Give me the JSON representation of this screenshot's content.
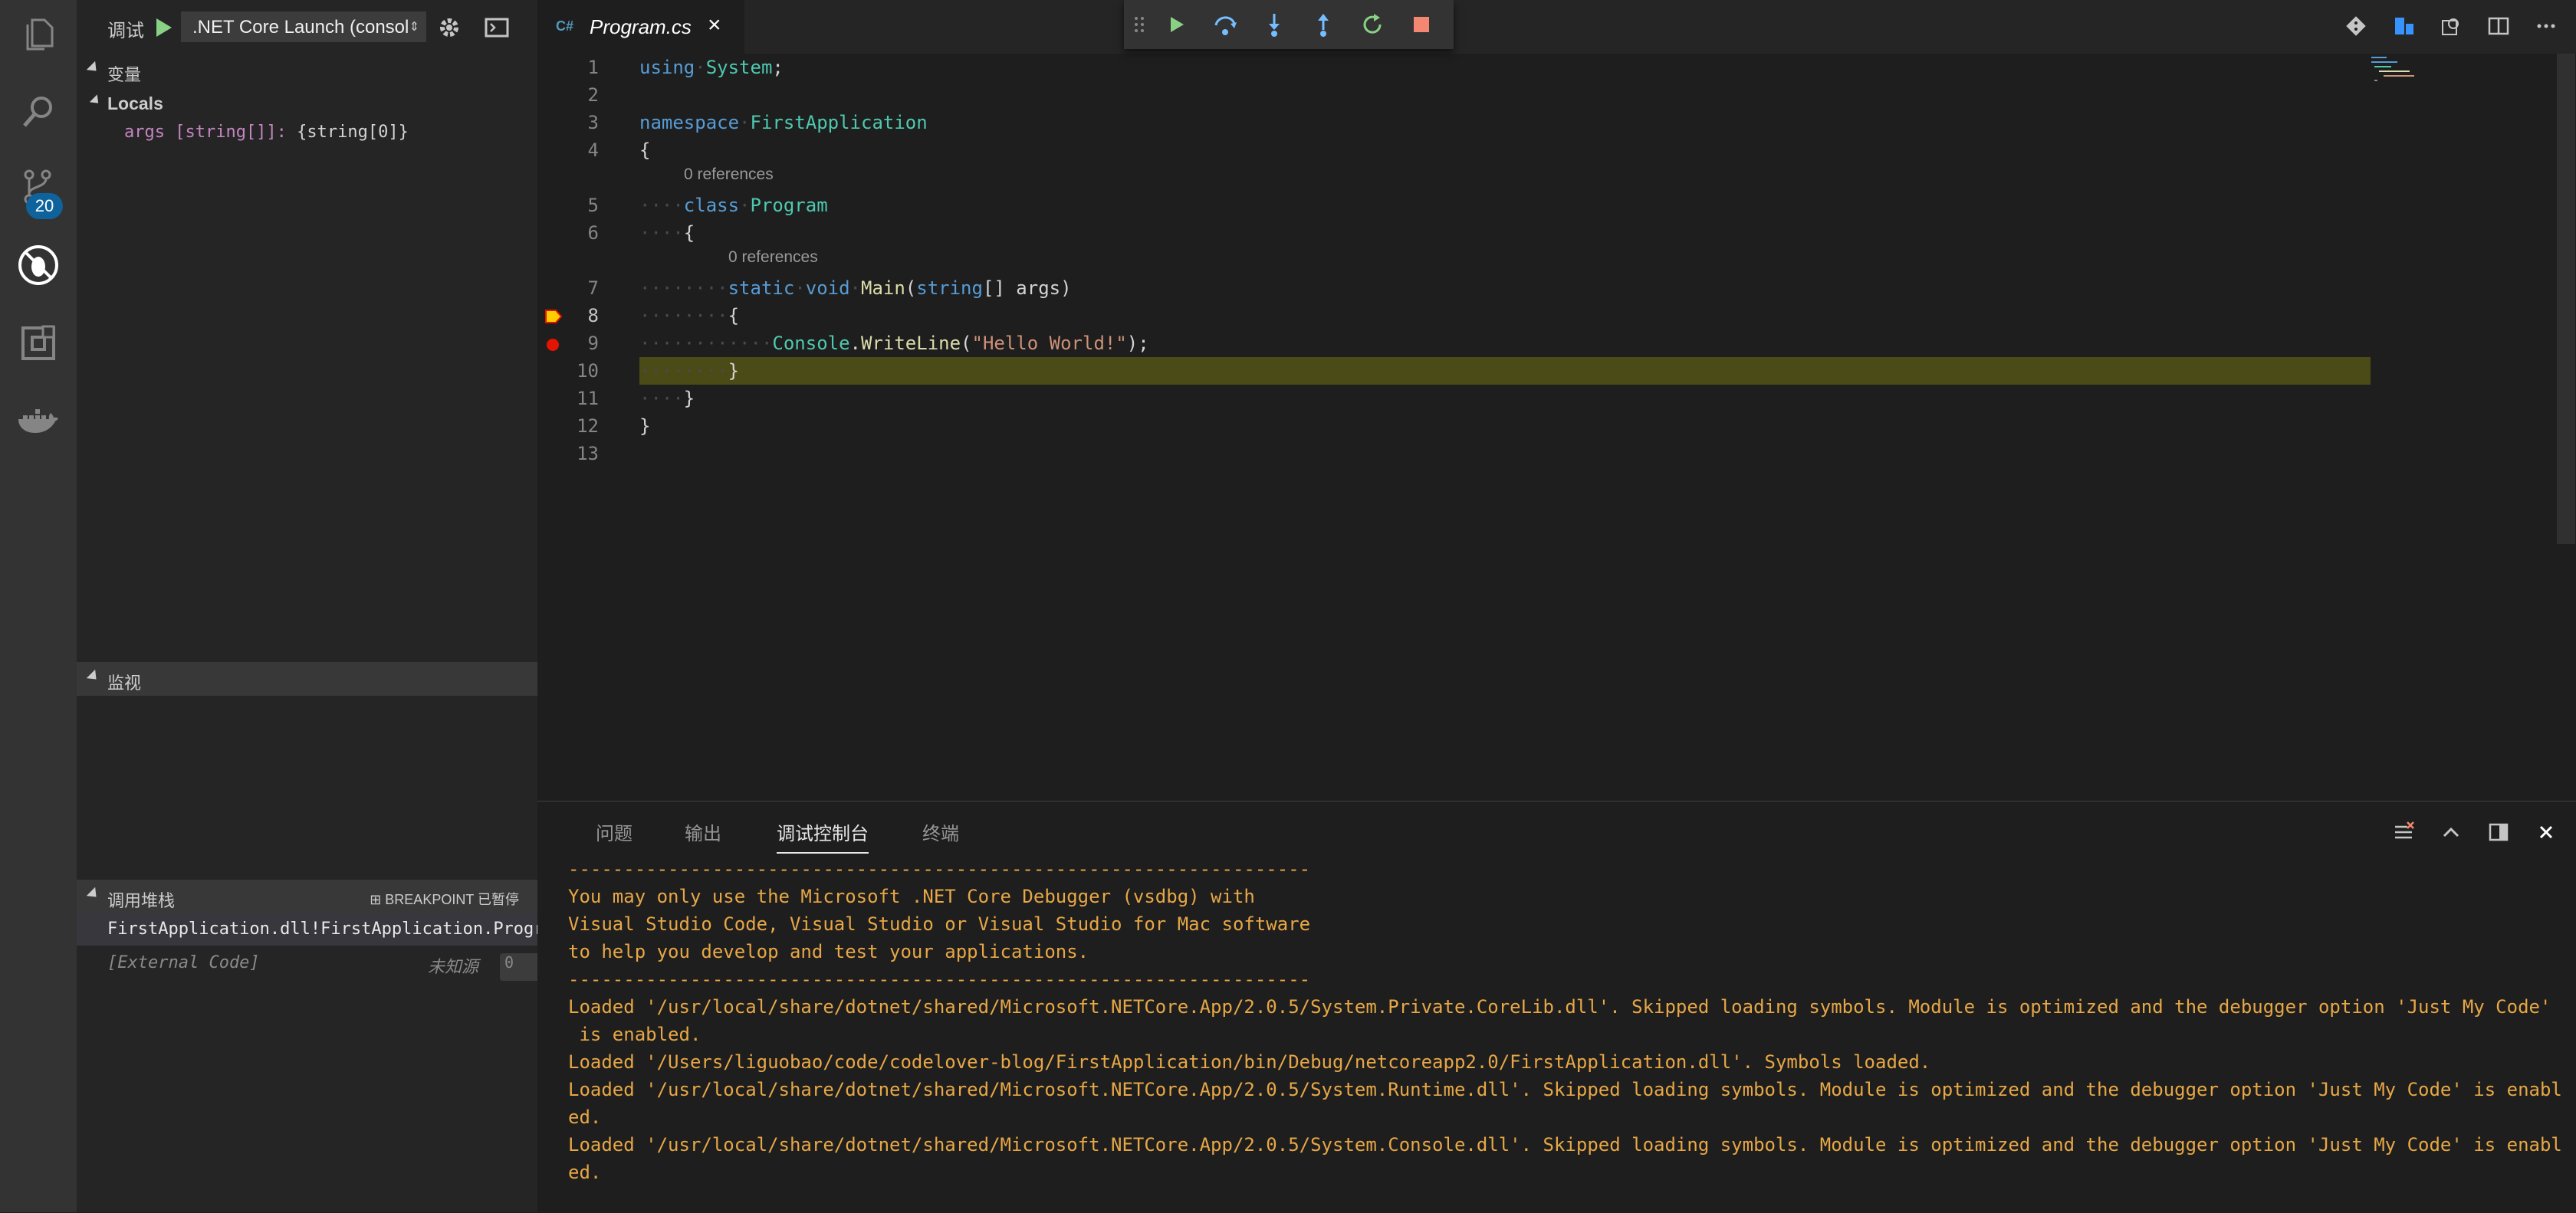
{
  "activity_bar": {
    "scm_badge": "20",
    "icons": [
      "files-icon",
      "search-icon",
      "source-control-icon",
      "debug-icon",
      "extensions-icon",
      "docker-icon"
    ]
  },
  "debug_toolbar": {
    "label": "调试",
    "config": ".NET Core Launch (consol"
  },
  "sidebar": {
    "variables": {
      "title": "变量",
      "locals_title": "Locals",
      "var_name": "args [string[]]:",
      "var_value": " {string[0]}"
    },
    "watch": {
      "title": "监视"
    },
    "call_stack": {
      "title": "调用堆栈",
      "status": "BREAKPOINT 已暂停",
      "frames": [
        {
          "name": "FirstApplication.dll!FirstApplication.Progr"
        },
        {
          "name": "[External Code]",
          "source": "未知源",
          "line": "0"
        }
      ]
    }
  },
  "editor": {
    "tab": {
      "label": "Program.cs",
      "icon": "C#"
    },
    "codelens": [
      "0 references",
      "0 references"
    ],
    "line_numbers": [
      "1",
      "2",
      "3",
      "4",
      "5",
      "6",
      "7",
      "8",
      "9",
      "10",
      "11",
      "12",
      "13"
    ],
    "current_line": "8",
    "breakpoint_line": "9",
    "code": {
      "l1_kw": "using",
      "l1_ns": "System",
      "l1_end": ";",
      "l3_kw": "namespace",
      "l3_ns": "FirstApplication",
      "l4": "{",
      "l5_kw": "class",
      "l5_ty": "Program",
      "l6": "{",
      "l7_kw1": "static",
      "l7_kw2": "void",
      "l7_fn": "Main",
      "l7_p1": "(",
      "l7_kw3": "string",
      "l7_p2": "[] args)",
      "l8": "{",
      "l9_ty": "Console",
      "l9_dot": ".",
      "l9_fn": "WriteLine",
      "l9_p1": "(",
      "l9_str": "\"Hello World!\"",
      "l9_p2": ");",
      "l10": "}",
      "l11": "}",
      "l12": "}"
    }
  },
  "panel": {
    "tabs": [
      "问题",
      "输出",
      "调试控制台",
      "终端"
    ],
    "active_tab": "调试控制台",
    "console_lines": [
      "-------------------------------------------------------------------",
      "You may only use the Microsoft .NET Core Debugger (vsdbg) with",
      "Visual Studio Code, Visual Studio or Visual Studio for Mac software",
      "to help you develop and test your applications.",
      "-------------------------------------------------------------------",
      "Loaded '/usr/local/share/dotnet/shared/Microsoft.NETCore.App/2.0.5/System.Private.CoreLib.dll'. Skipped loading symbols. Module is optimized and the debugger option 'Just My Code'",
      " is enabled.",
      "Loaded '/Users/liguobao/code/codelover-blog/FirstApplication/bin/Debug/netcoreapp2.0/FirstApplication.dll'. Symbols loaded.",
      "Loaded '/usr/local/share/dotnet/shared/Microsoft.NETCore.App/2.0.5/System.Runtime.dll'. Skipped loading symbols. Module is optimized and the debugger option 'Just My Code' is enabl",
      "ed.",
      "Loaded '/usr/local/share/dotnet/shared/Microsoft.NETCore.App/2.0.5/System.Console.dll'. Skipped loading symbols. Module is optimized and the debugger option 'Just My Code' is enabl",
      "ed."
    ]
  },
  "colors": {
    "accent": "#0e639c",
    "console_text": "#e7a746",
    "breakpoint": "#e51400",
    "current_line": "#4b4b18"
  }
}
